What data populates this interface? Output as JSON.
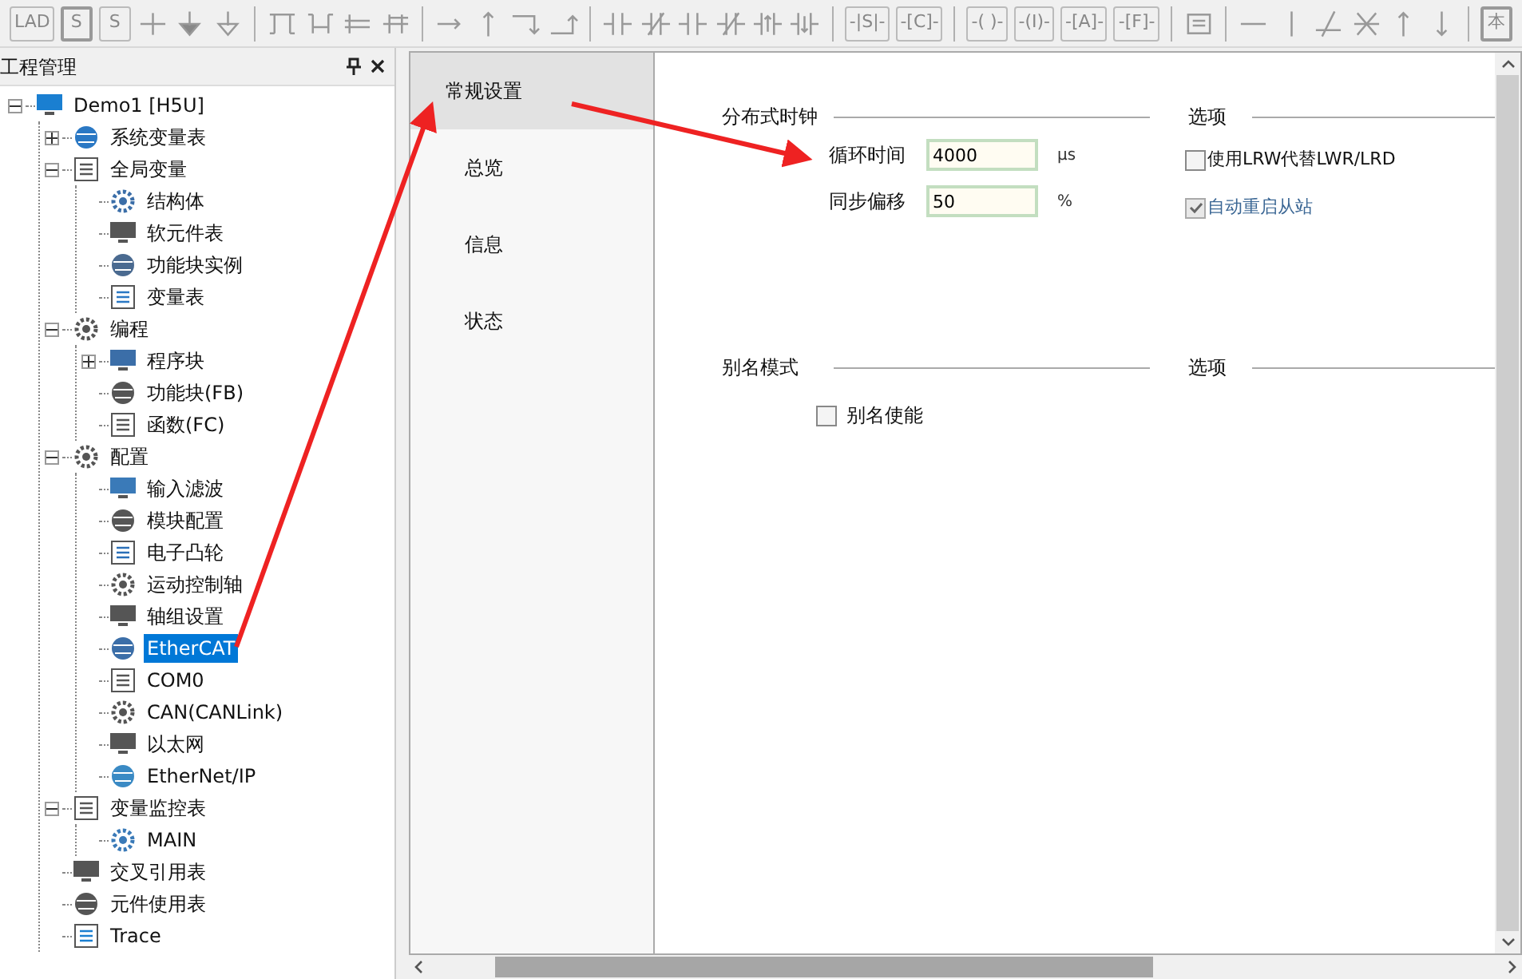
{
  "toolbar": [
    {
      "kind": "label",
      "text": "LAD",
      "boxed": false
    },
    {
      "kind": "label",
      "text": "S",
      "boxed": true
    },
    {
      "kind": "label",
      "text": "S",
      "boxed": false
    },
    {
      "kind": "icon"
    },
    {
      "kind": "icon"
    },
    {
      "kind": "icon"
    },
    {
      "kind": "separator"
    },
    {
      "kind": "icon"
    },
    {
      "kind": "icon"
    },
    {
      "kind": "icon"
    },
    {
      "kind": "icon"
    },
    {
      "kind": "separator"
    },
    {
      "kind": "icon"
    },
    {
      "kind": "icon"
    },
    {
      "kind": "icon"
    },
    {
      "kind": "icon"
    },
    {
      "kind": "separator"
    },
    {
      "kind": "icon"
    },
    {
      "kind": "icon"
    },
    {
      "kind": "icon"
    },
    {
      "kind": "icon"
    },
    {
      "kind": "icon"
    },
    {
      "kind": "icon"
    },
    {
      "kind": "separator"
    },
    {
      "kind": "label",
      "text": "-|S|-",
      "boxed": false
    },
    {
      "kind": "label",
      "text": "-[C]-",
      "boxed": false
    },
    {
      "kind": "separator"
    },
    {
      "kind": "label",
      "text": "-( )-",
      "boxed": false
    },
    {
      "kind": "label",
      "text": "-(I)-",
      "boxed": false
    },
    {
      "kind": "label",
      "text": "-[A]-",
      "boxed": false
    },
    {
      "kind": "label",
      "text": "-[F]-",
      "boxed": false
    },
    {
      "kind": "separator"
    },
    {
      "kind": "icon"
    },
    {
      "kind": "separator"
    },
    {
      "kind": "icon"
    },
    {
      "kind": "icon"
    },
    {
      "kind": "icon"
    },
    {
      "kind": "icon"
    },
    {
      "kind": "icon"
    },
    {
      "kind": "icon"
    },
    {
      "kind": "separator"
    },
    {
      "kind": "label",
      "text": "本",
      "boxed": true
    }
  ],
  "project_panel": {
    "title": "工程管理",
    "tree": [
      {
        "label": "Demo1 [H5U]",
        "expanded": true,
        "selected": false,
        "children": [
          {
            "label": "系统变量表",
            "expanded": false,
            "selected": false
          },
          {
            "label": "全局变量",
            "expanded": true,
            "selected": false,
            "children": [
              {
                "label": "结构体",
                "selected": false
              },
              {
                "label": "软元件表",
                "selected": false
              },
              {
                "label": "功能块实例",
                "selected": false
              },
              {
                "label": "变量表",
                "selected": false
              }
            ]
          },
          {
            "label": "编程",
            "expanded": true,
            "selected": false,
            "children": [
              {
                "label": "程序块",
                "expanded": false,
                "selected": false
              },
              {
                "label": "功能块(FB)",
                "selected": false
              },
              {
                "label": "函数(FC)",
                "selected": false
              }
            ]
          },
          {
            "label": "配置",
            "expanded": true,
            "selected": false,
            "children": [
              {
                "label": "输入滤波",
                "selected": false
              },
              {
                "label": "模块配置",
                "selected": false
              },
              {
                "label": "电子凸轮",
                "selected": false
              },
              {
                "label": "运动控制轴",
                "selected": false
              },
              {
                "label": "轴组设置",
                "selected": false
              },
              {
                "label": "EtherCAT",
                "selected": true
              },
              {
                "label": "COM0",
                "selected": false
              },
              {
                "label": "CAN(CANLink)",
                "selected": false
              },
              {
                "label": "以太网",
                "selected": false
              },
              {
                "label": "EtherNet/IP",
                "selected": false
              }
            ]
          },
          {
            "label": "变量监控表",
            "expanded": true,
            "selected": false,
            "children": [
              {
                "label": "MAIN",
                "selected": false
              }
            ]
          },
          {
            "label": "交叉引用表",
            "selected": false
          },
          {
            "label": "元件使用表",
            "selected": false
          },
          {
            "label": "Trace",
            "selected": false
          }
        ]
      }
    ]
  },
  "tabs": [
    {
      "label": "常规设置",
      "selected": true
    },
    {
      "label": "总览",
      "selected": false
    },
    {
      "label": "信息",
      "selected": false
    },
    {
      "label": "状态",
      "selected": false
    }
  ],
  "sections": [
    {
      "title": "分布式时钟",
      "options_title": "选项",
      "fields": [
        {
          "label": "循环时间",
          "value": "4000",
          "unit": "μs"
        },
        {
          "label": "同步偏移",
          "value": "50",
          "unit": "%"
        }
      ],
      "options": [
        {
          "label": "使用LRW代替LWR/LRD",
          "checked": false,
          "disabled": false
        },
        {
          "label": "自动重启从站",
          "checked": true,
          "disabled": true
        }
      ]
    },
    {
      "title": "别名模式",
      "options_title": "选项",
      "checkboxes": [
        {
          "label": "别名使能",
          "checked": false
        }
      ]
    }
  ]
}
